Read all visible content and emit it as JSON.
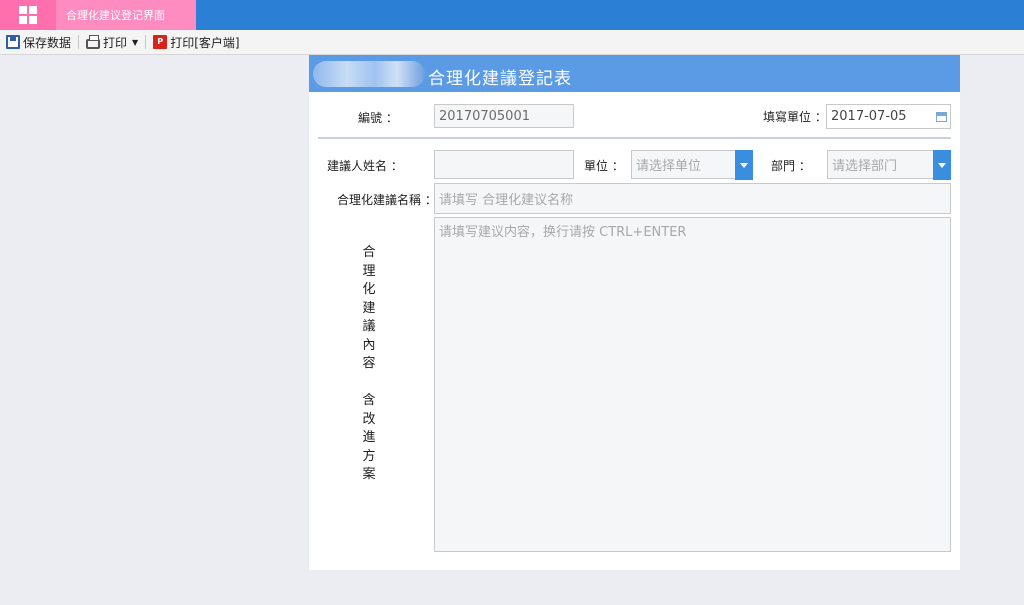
{
  "header": {
    "home_icon": "grid-icon",
    "tab_label": "合理化建议登记界面"
  },
  "toolbar": {
    "save_label": "保存数据",
    "print_label": "打印",
    "print_client_label": "打印[客户端]"
  },
  "form": {
    "title": "合理化建議登記表",
    "number_label": "編號 ：",
    "number_value": "20170705001",
    "fill_unit_label": "填寫單位 ：",
    "date_value": "2017-07-05",
    "name_label": "建議人姓名 ：",
    "name_value": "",
    "unit_label": "單位 ：",
    "unit_placeholder": "请选择单位",
    "dept_label": "部門 ：",
    "dept_placeholder": "请选择部门",
    "suggestion_name_label": "合理化建議名稱 ：",
    "suggestion_name_placeholder": "请填写 合理化建议名称",
    "content_placeholder": "请填写建议内容，换行请按 CTRL+ENTER",
    "content_label_part1": [
      "合",
      "理",
      "化",
      "建",
      "議",
      "內",
      "容"
    ],
    "content_label_part2": [
      "含",
      "改",
      "進",
      "方",
      "案"
    ]
  },
  "colors": {
    "topbar": "#2b7fd4",
    "home_tab": "#ff6fae",
    "page_tab": "#ff8cc0",
    "form_header": "#5b9be6",
    "select_button": "#3a8ee0"
  }
}
